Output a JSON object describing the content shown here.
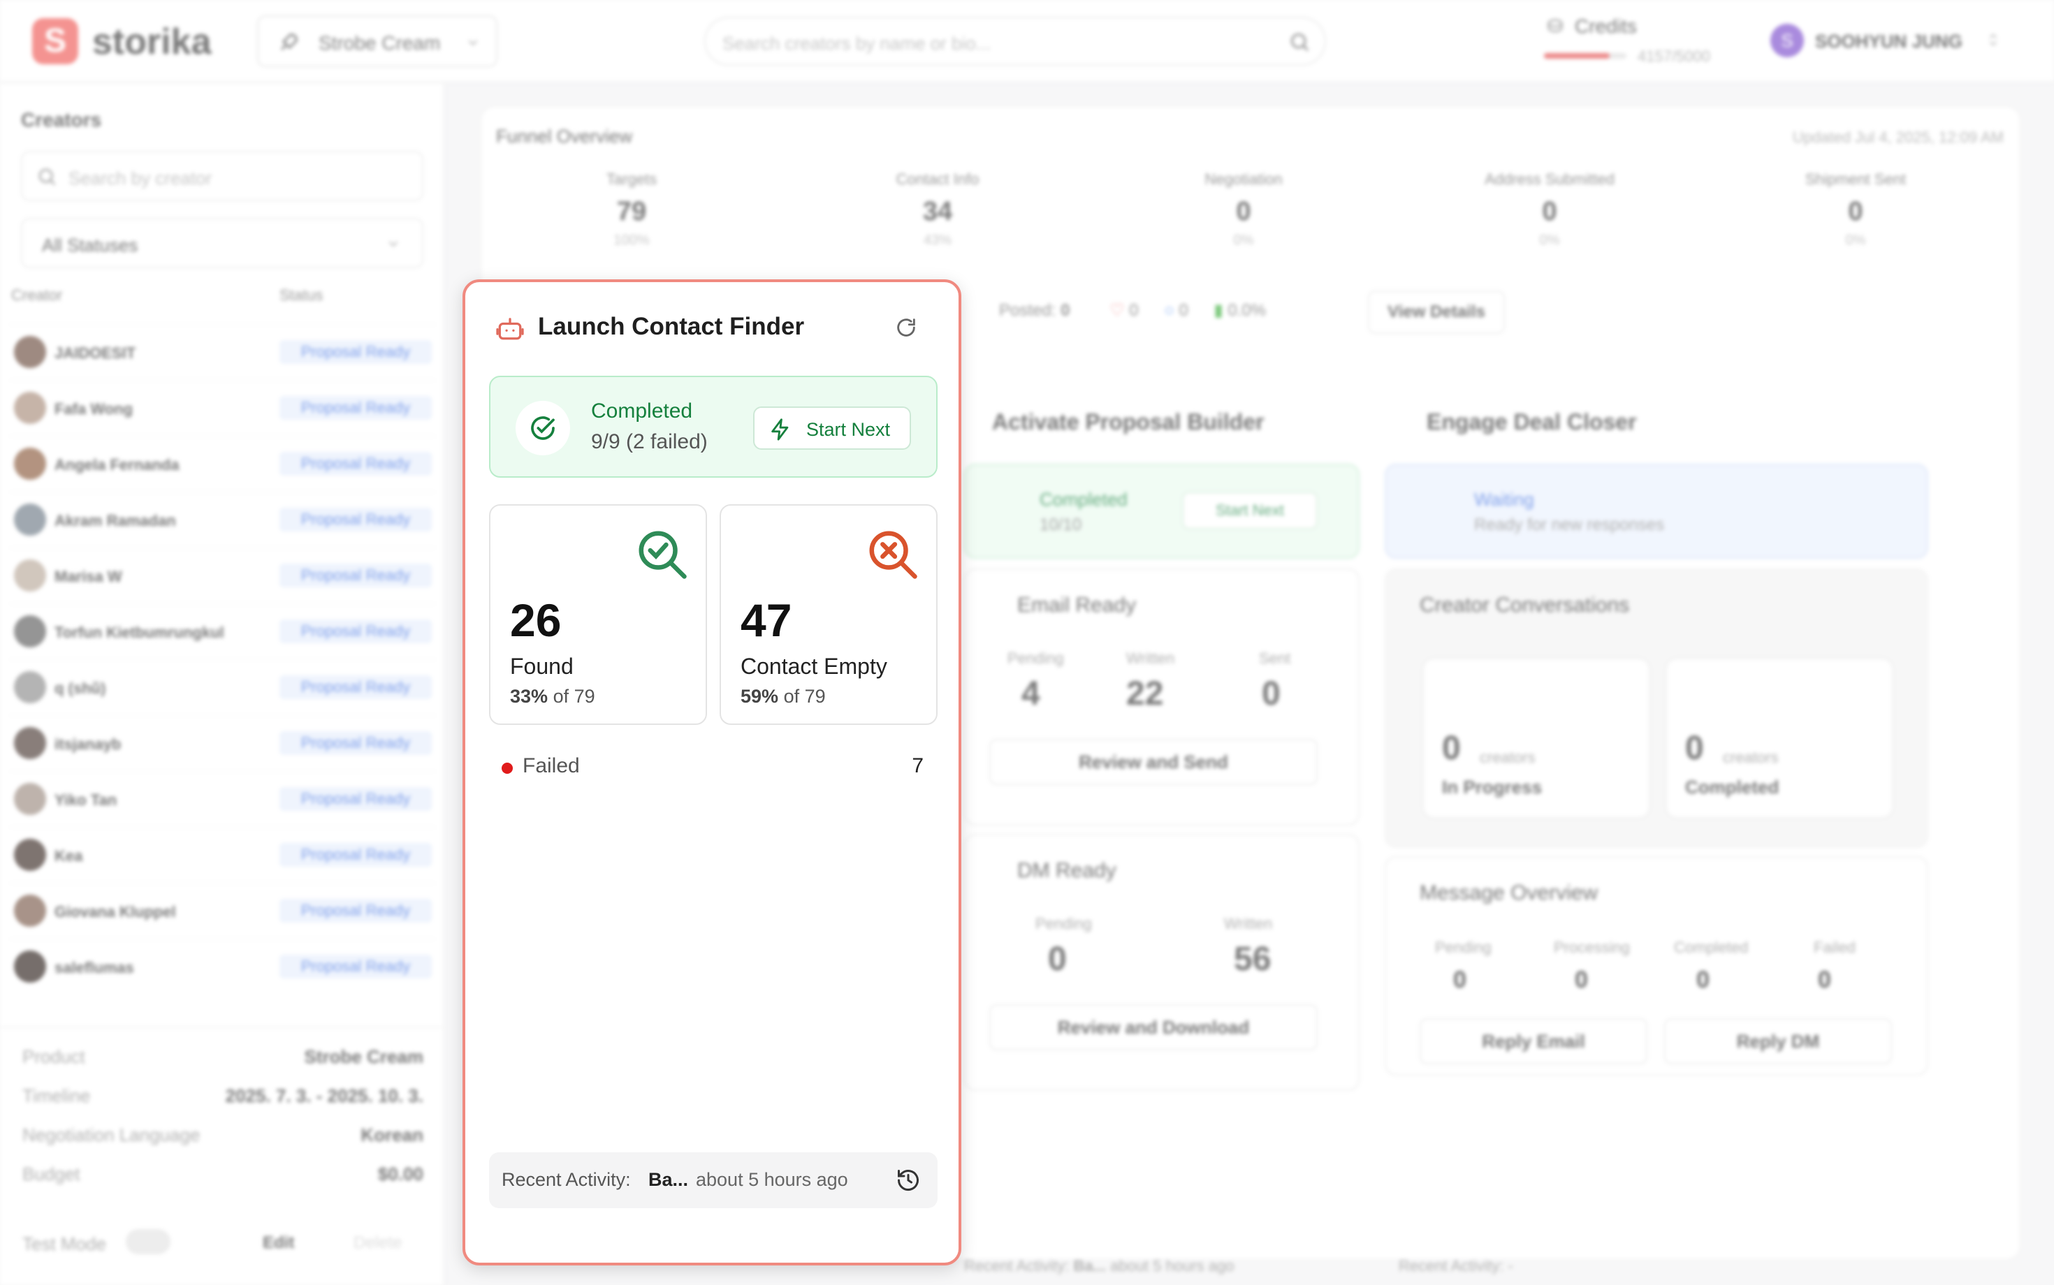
{
  "header": {
    "logo_letter": "S",
    "logo_text": "storika",
    "product_select": "Strobe Cream",
    "search_placeholder": "Search creators by name or bio...",
    "credits_label": "Credits",
    "credits_value": "4157/5000",
    "credits_used_fraction": 0.83,
    "user_initial": "S",
    "user_name": "SOOHYUN JUNG"
  },
  "sidebar": {
    "title": "Creators",
    "search_placeholder": "Search by creator",
    "filter_value": "All Statuses",
    "col_creator": "Creator",
    "col_status": "Status",
    "rows": [
      {
        "name": "JAIDOESIT",
        "status": "Proposal Ready"
      },
      {
        "name": "Fafa Wong",
        "status": "Proposal Ready"
      },
      {
        "name": "Angela Fernanda",
        "status": "Proposal Ready"
      },
      {
        "name": "Akram Ramadan",
        "status": "Proposal Ready"
      },
      {
        "name": "Marisa W",
        "status": "Proposal Ready"
      },
      {
        "name": "Torfun Kietbumrungkul",
        "status": "Proposal Ready"
      },
      {
        "name": "q (shǔ)",
        "status": "Proposal Ready"
      },
      {
        "name": "itsjanayb",
        "status": "Proposal Ready"
      },
      {
        "name": "Yiko Tan",
        "status": "Proposal Ready"
      },
      {
        "name": "Kea",
        "status": "Proposal Ready"
      },
      {
        "name": "Giovana Kluppel",
        "status": "Proposal Ready"
      },
      {
        "name": "saleflumas",
        "status": "Proposal Ready"
      }
    ],
    "meta": {
      "product_label": "Product",
      "product_value": "Strobe Cream",
      "timeline_label": "Timeline",
      "timeline_value": "2025. 7. 3. - 2025. 10. 3.",
      "lang_label": "Negotiation Language",
      "lang_value": "Korean",
      "budget_label": "Budget",
      "budget_value": "$0.00"
    },
    "test_mode_label": "Test Mode",
    "edit_label": "Edit",
    "delete_label": "Delete"
  },
  "funnel": {
    "title": "Funnel Overview",
    "updated": "Updated Jul 4, 2025, 12:09 AM",
    "columns": [
      {
        "label": "Targets",
        "value": "79",
        "pct": "100%"
      },
      {
        "label": "Contact Info",
        "value": "34",
        "pct": "43%"
      },
      {
        "label": "Negotiation",
        "value": "0",
        "pct": "0%"
      },
      {
        "label": "Address Submitted",
        "value": "0",
        "pct": "0%"
      },
      {
        "label": "Shipment Sent",
        "value": "0",
        "pct": "0%"
      }
    ],
    "posted_label": "Posted:",
    "posted_value": "0",
    "likes": "0",
    "comments": "0",
    "engagement": "0.0%",
    "view_details": "View Details"
  },
  "proposal_builder": {
    "title": "Activate Proposal Builder",
    "status": "Completed",
    "status_detail": "10/10",
    "start_next": "Start Next",
    "email": {
      "title": "Email Ready",
      "pending_label": "Pending",
      "pending": "4",
      "written_label": "Written",
      "written": "22",
      "sent_label": "Sent",
      "sent": "0",
      "button": "Review and Send"
    },
    "dm": {
      "title": "DM Ready",
      "pending_label": "Pending",
      "pending": "0",
      "written_label": "Written",
      "written": "56",
      "button": "Review and Download"
    },
    "recent_label": "Recent Activity:",
    "recent_value": "Ba...",
    "recent_time": "about 5 hours ago"
  },
  "deal_closer": {
    "title": "Engage Deal Closer",
    "status": "Waiting",
    "status_detail": "Ready for new responses",
    "conversations_title": "Creator Conversations",
    "in_progress_value": "0",
    "in_progress_unit": "creators",
    "in_progress_label": "In Progress",
    "completed_value": "0",
    "completed_unit": "creators",
    "completed_label": "Completed",
    "message_overview_title": "Message Overview",
    "msg": [
      {
        "label": "Pending",
        "value": "0"
      },
      {
        "label": "Processing",
        "value": "0"
      },
      {
        "label": "Completed",
        "value": "0"
      },
      {
        "label": "Failed",
        "value": "0"
      }
    ],
    "reply_email": "Reply Email",
    "reply_dm": "Reply DM",
    "recent_label": "Recent Activity:",
    "recent_value": "-"
  },
  "contact_finder": {
    "title": "Launch Contact Finder",
    "status": "Completed",
    "status_detail": "9/9 (2 failed)",
    "start_next": "Start Next",
    "found_value": "26",
    "found_label": "Found",
    "found_pct": "33%",
    "found_of": "of 79",
    "empty_value": "47",
    "empty_label": "Contact Empty",
    "empty_pct": "59%",
    "empty_of": "of 79",
    "failed_label": "Failed",
    "failed_value": "7",
    "recent_label": "Recent Activity:",
    "recent_value": "Ba...",
    "recent_time": "about 5 hours ago"
  },
  "colors": {
    "brand": "#ef5a56",
    "success": "#15803d",
    "danger": "#e01b1b",
    "orange": "#d9532c",
    "link_blue": "#3e6fe0"
  }
}
